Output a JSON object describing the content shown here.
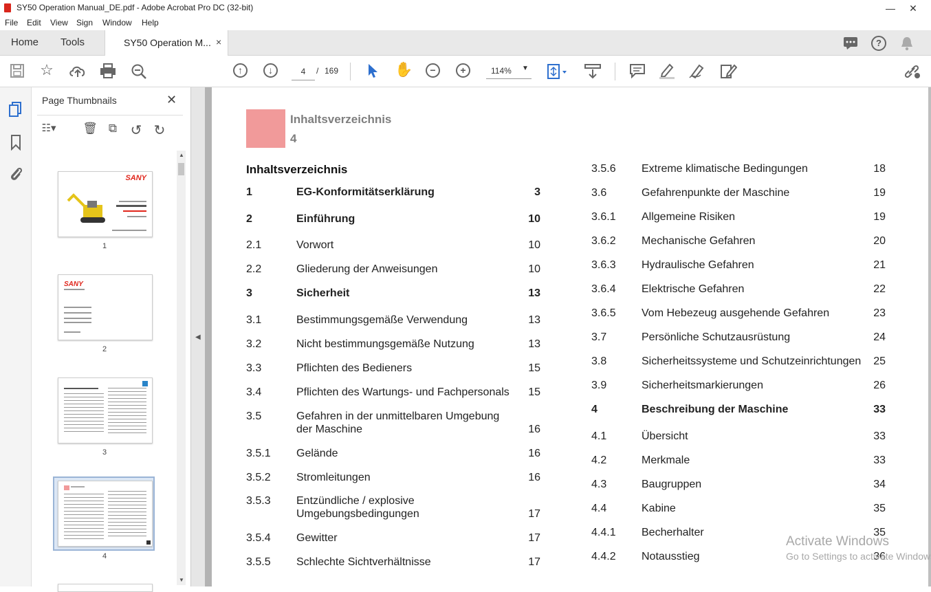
{
  "window": {
    "title": "SY50 Operation Manual_DE.pdf - Adobe Acrobat Pro DC (32-bit)",
    "minimize": "—",
    "close": "✕"
  },
  "menu": [
    "File",
    "Edit",
    "View",
    "Sign",
    "Window",
    "Help"
  ],
  "tabs": {
    "home": "Home",
    "tools": "Tools",
    "document": "SY50 Operation M...",
    "document_close": "×"
  },
  "toolbar": {
    "page_current": "4",
    "page_sep": "/",
    "page_total": "169",
    "zoom": "114%"
  },
  "thumbnails": {
    "header": "Page Thumbnails",
    "close": "✕",
    "pages": [
      {
        "number": "1",
        "brand": "SANY"
      },
      {
        "number": "2",
        "brand": "SANY"
      },
      {
        "number": "3"
      },
      {
        "number": "4"
      }
    ]
  },
  "document": {
    "header_title": "Inhaltsverzeichnis",
    "header_number": "4",
    "toc_heading": "Inhaltsverzeichnis",
    "toc_left": [
      {
        "num": "1",
        "title": "EG-Konformitätserklärung",
        "page": "3",
        "bold": true
      },
      {
        "num": "2",
        "title": "Einführung",
        "page": "10",
        "bold": true
      },
      {
        "num": "2.1",
        "title": "Vorwort",
        "page": "10"
      },
      {
        "num": "2.2",
        "title": "Gliederung der Anweisungen",
        "page": "10"
      },
      {
        "num": "3",
        "title": "Sicherheit",
        "page": "13",
        "bold": true
      },
      {
        "num": "3.1",
        "title": "Bestimmungsgemäße Verwendung",
        "page": "13"
      },
      {
        "num": "3.2",
        "title": "Nicht bestimmungsgemäße Nutzung",
        "page": "13"
      },
      {
        "num": "3.3",
        "title": "Pflichten des Bedieners",
        "page": "15"
      },
      {
        "num": "3.4",
        "title": "Pflichten des Wartungs- und Fachpersonals",
        "page": "15"
      },
      {
        "num": "3.5",
        "title": "Gefahren in der unmittelbaren Umgebung",
        "title2": "der Maschine",
        "page": "16"
      },
      {
        "num": "3.5.1",
        "title": "Gelände",
        "page": "16"
      },
      {
        "num": "3.5.2",
        "title": "Stromleitungen",
        "page": "16"
      },
      {
        "num": "3.5.3",
        "title": "Entzündliche / explosive",
        "title2": "Umgebungsbedingungen",
        "page": "17"
      },
      {
        "num": "3.5.4",
        "title": "Gewitter",
        "page": "17"
      },
      {
        "num": "3.5.5",
        "title": "Schlechte Sichtverhältnisse",
        "page": "17"
      }
    ],
    "toc_right": [
      {
        "num": "3.5.6",
        "title": "Extreme klimatische Bedingungen",
        "page": "18"
      },
      {
        "num": "3.6",
        "title": "Gefahrenpunkte der Maschine",
        "page": "19"
      },
      {
        "num": "3.6.1",
        "title": "Allgemeine Risiken",
        "page": "19"
      },
      {
        "num": "3.6.2",
        "title": "Mechanische Gefahren",
        "page": "20"
      },
      {
        "num": "3.6.3",
        "title": "Hydraulische Gefahren",
        "page": "21"
      },
      {
        "num": "3.6.4",
        "title": "Elektrische Gefahren",
        "page": "22"
      },
      {
        "num": "3.6.5",
        "title": "Vom Hebezeug ausgehende Gefahren",
        "page": "23"
      },
      {
        "num": "3.7",
        "title": "Persönliche Schutzausrüstung",
        "page": "24"
      },
      {
        "num": "3.8",
        "title": "Sicherheitssysteme und Schutzeinrichtungen",
        "page": "25"
      },
      {
        "num": "3.9",
        "title": "Sicherheitsmarkierungen",
        "page": "26"
      },
      {
        "num": "4",
        "title": "Beschreibung der Maschine",
        "page": "33",
        "bold": true
      },
      {
        "num": "4.1",
        "title": "Übersicht",
        "page": "33"
      },
      {
        "num": "4.2",
        "title": "Merkmale",
        "page": "33"
      },
      {
        "num": "4.3",
        "title": "Baugruppen",
        "page": "34"
      },
      {
        "num": "4.4",
        "title": "Kabine",
        "page": "35"
      },
      {
        "num": "4.4.1",
        "title": "Becherhalter",
        "page": "35"
      },
      {
        "num": "4.4.2",
        "title": "Notausstieg",
        "page": "36"
      }
    ]
  },
  "watermark": {
    "line1": "Activate Windows",
    "line2": "Go to Settings to activate Windows."
  }
}
